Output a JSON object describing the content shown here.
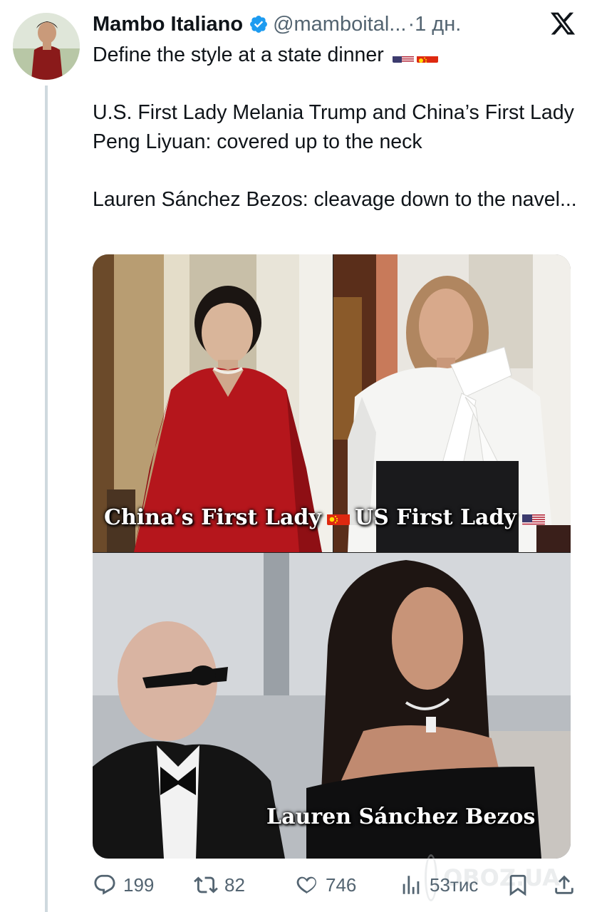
{
  "author": {
    "name": "Mambo Italiano",
    "handle": "@mamboital...",
    "time": "·1 дн.",
    "avatar_icon": "profile-photo"
  },
  "tweet": {
    "line1": "Define the style at a state dinner",
    "paragraph2": "U.S. First Lady Melania Trump and China’s First Lady Peng Liyuan: covered up to the neck",
    "paragraph3": "Lauren Sánchez Bezos: cleavage down to the navel..."
  },
  "media": {
    "captions": {
      "china": "China’s First Lady",
      "us": "US First Lady",
      "bezos": "Lauren Sánchez Bezos"
    }
  },
  "actions": {
    "replies": "199",
    "reposts": "82",
    "likes": "746",
    "views": "53тис"
  },
  "watermark": "OBOZ.UA",
  "colors": {
    "text": "#0f1419",
    "secondary": "#536471",
    "verified": "#1d9bf0",
    "thread_line": "#cfd9de"
  },
  "icons": [
    "verified-badge-icon",
    "x-logo-icon",
    "reply-icon",
    "repost-icon",
    "like-icon",
    "views-icon",
    "bookmark-icon",
    "share-icon",
    "us-flag-icon",
    "china-flag-icon"
  ]
}
